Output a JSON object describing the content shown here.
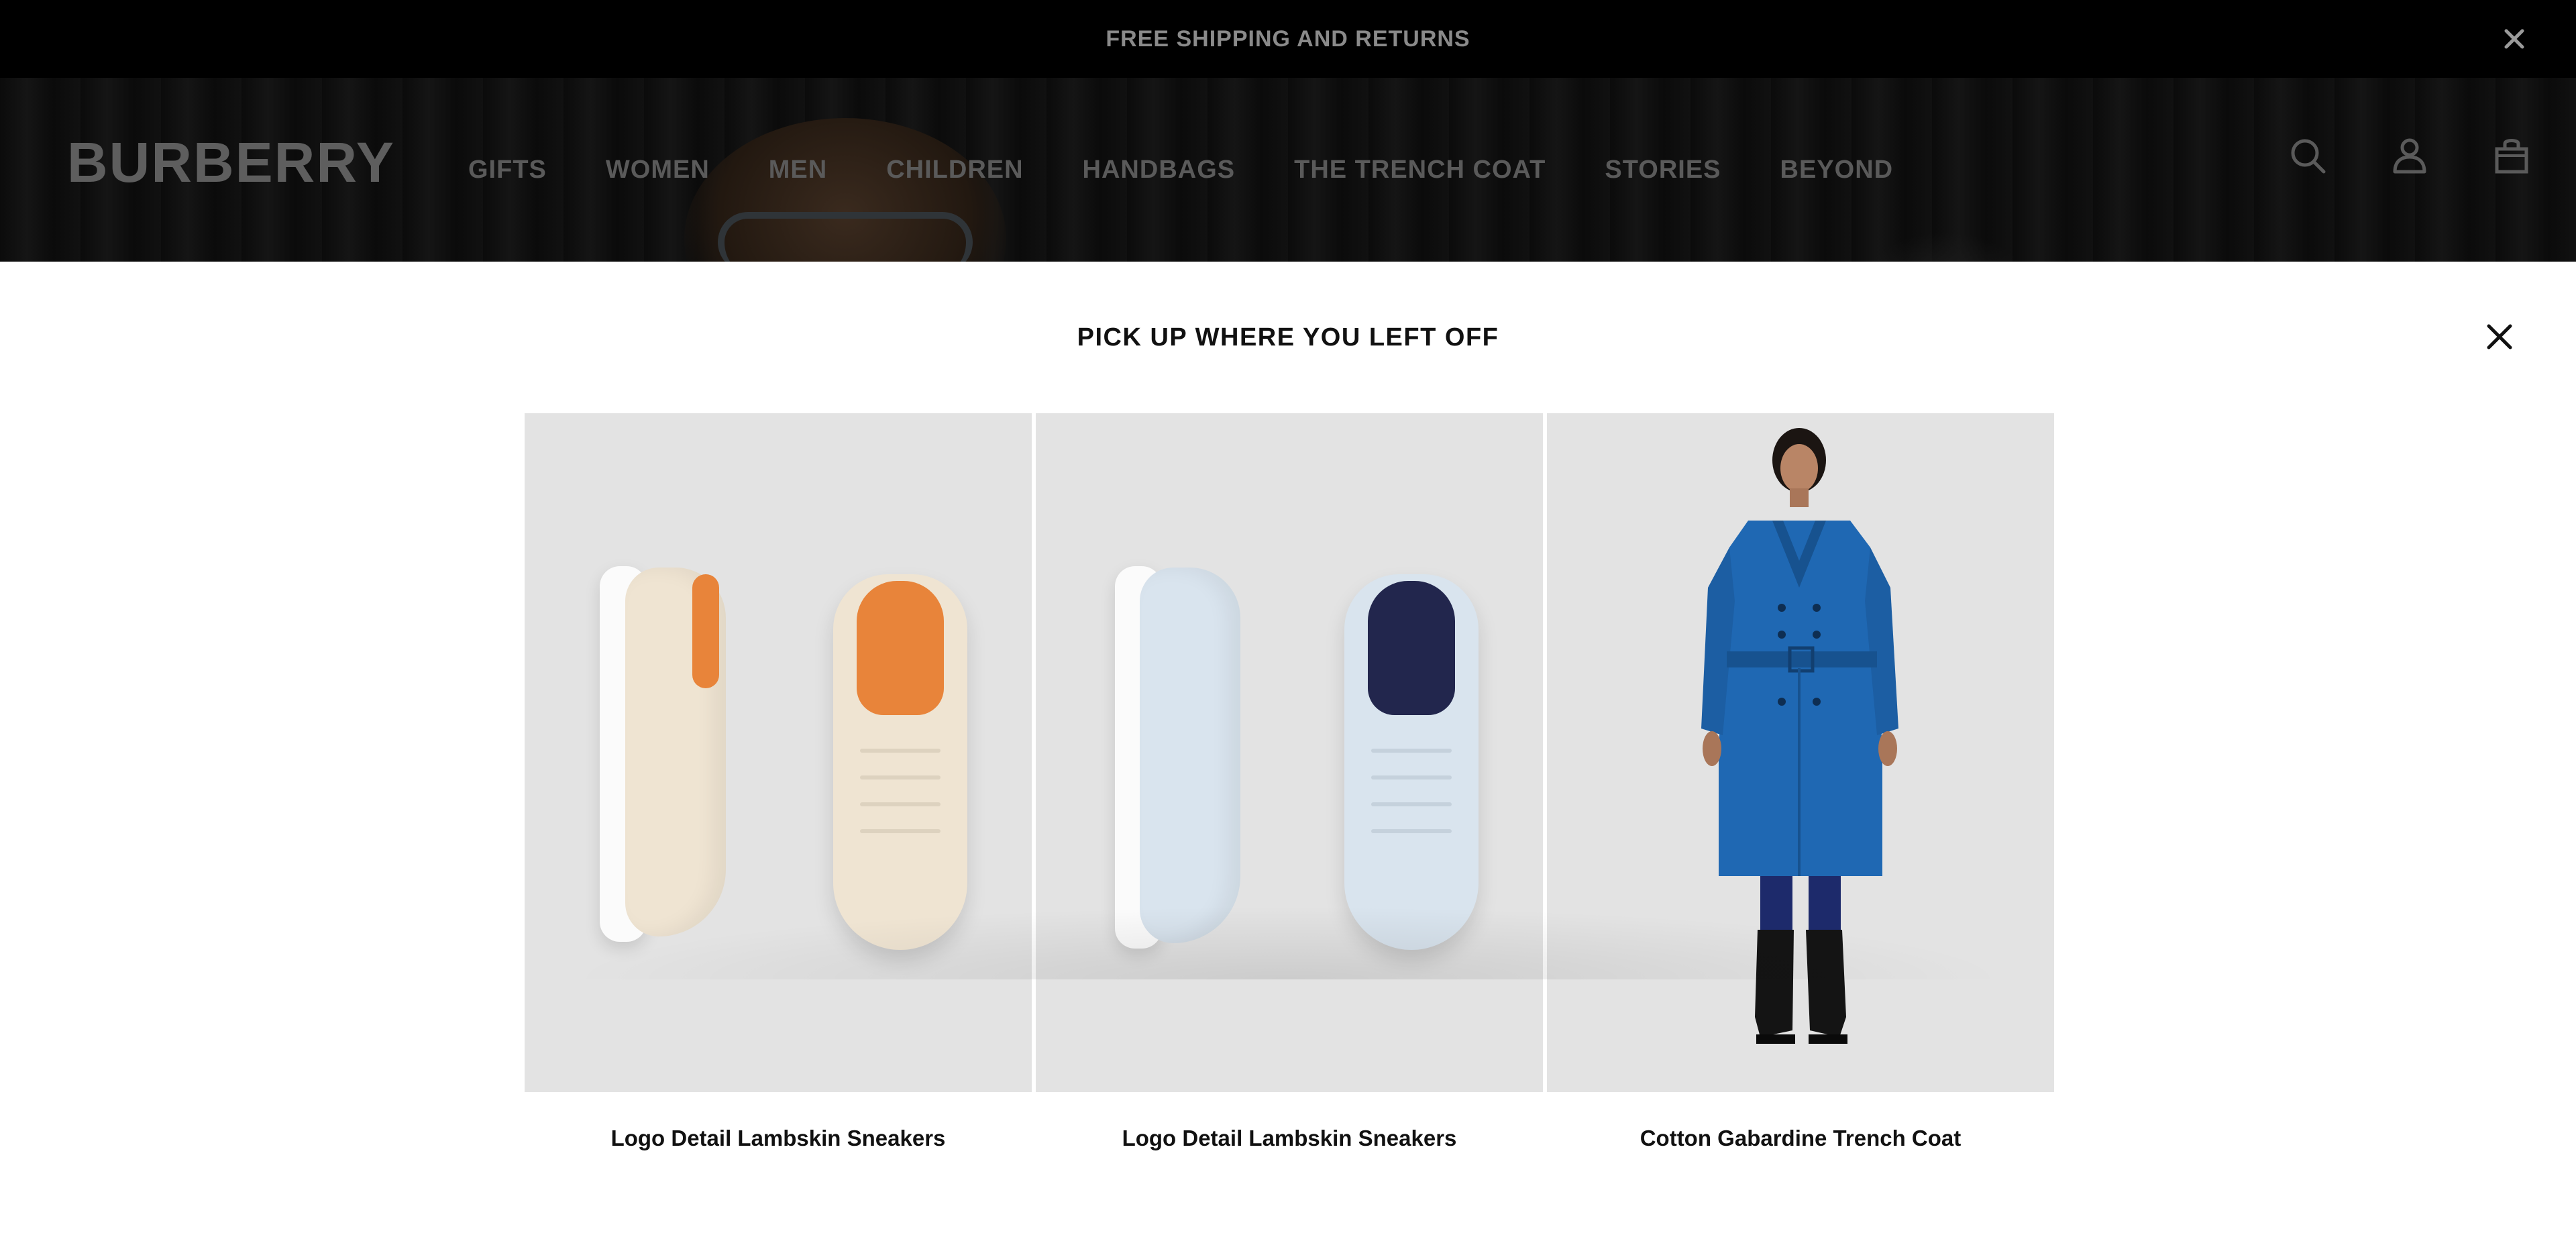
{
  "promo": {
    "text": "FREE SHIPPING AND RETURNS"
  },
  "header": {
    "logo": "BURBERRY",
    "nav": [
      "GIFTS",
      "WOMEN",
      "MEN",
      "CHILDREN",
      "HANDBAGS",
      "THE TRENCH COAT",
      "STORIES",
      "BEYOND"
    ],
    "icons": [
      "search-icon",
      "account-icon",
      "bag-icon"
    ]
  },
  "modal": {
    "title": "PICK UP WHERE YOU LEFT OFF",
    "close_icon": "close-icon",
    "products": [
      {
        "name": "Logo Detail Lambskin Sneakers",
        "color": "#efe4d2",
        "lining": "#e8843a"
      },
      {
        "name": "Logo Detail Lambskin Sneakers",
        "color": "#d9e4ee",
        "lining": "#22264d"
      },
      {
        "name": "Cotton Gabardine Trench Coat",
        "color": "#1f68b3"
      }
    ]
  },
  "colors": {
    "overlay_dark": "#000000",
    "modal_bg": "#ffffff",
    "card_bg": "#e3e3e3"
  }
}
